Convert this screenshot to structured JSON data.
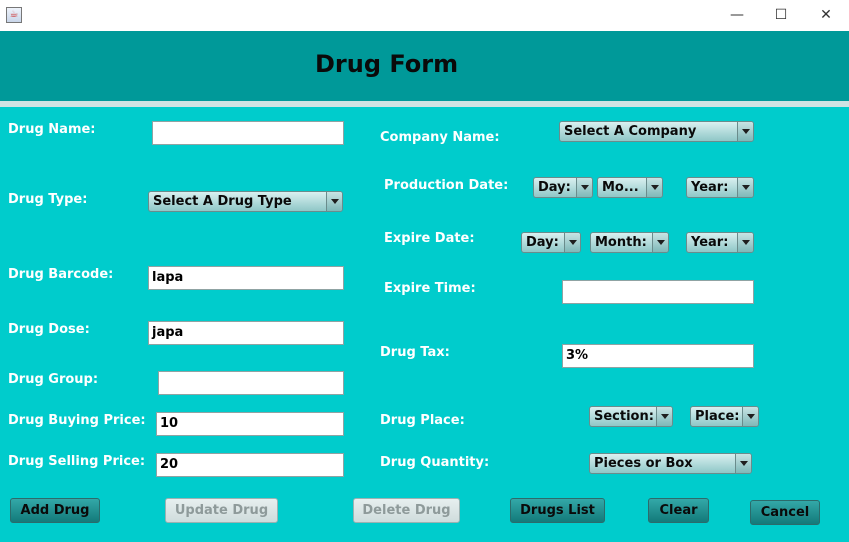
{
  "window": {
    "icon_glyph": "☕",
    "minimize": "—",
    "maximize": "☐",
    "close": "✕"
  },
  "header": {
    "title": "Drug Form"
  },
  "left": {
    "drug_name": {
      "label": "Drug Name:",
      "value": ""
    },
    "drug_type": {
      "label": "Drug Type:",
      "selected": "Select A Drug Type"
    },
    "drug_barcode": {
      "label": "Drug Barcode:",
      "value": "lapa"
    },
    "drug_dose": {
      "label": "Drug Dose:",
      "value": "japa"
    },
    "drug_group": {
      "label": "Drug Group:",
      "value": ""
    },
    "buying_price": {
      "label": "Drug Buying Price:",
      "value": "10"
    },
    "selling_price": {
      "label": "Drug Selling Price:",
      "value": "20"
    }
  },
  "right": {
    "company_name": {
      "label": "Company Name:",
      "selected": "Select A Company"
    },
    "production_date": {
      "label": "Production Date:",
      "day": "Day:",
      "month": "Mo...",
      "year": "Year:"
    },
    "expire_date": {
      "label": "Expire Date:",
      "day": "Day:",
      "month": "Month:",
      "year": "Year:"
    },
    "expire_time": {
      "label": "Expire Time:",
      "value": ""
    },
    "drug_tax": {
      "label": "Drug Tax:",
      "value": "3%"
    },
    "drug_place": {
      "label": "Drug Place:",
      "section": "Section:",
      "place": "Place:"
    },
    "drug_quantity": {
      "label": "Drug Quantity:",
      "selected": "Pieces or Box"
    }
  },
  "buttons": {
    "add": "Add Drug",
    "update": "Update Drug",
    "delete": "Delete Drug",
    "list": "Drugs List",
    "clear": "Clear",
    "cancel": "Cancel"
  },
  "colors": {
    "background": "#00cccc",
    "header": "#009999",
    "button": "#137a7a",
    "label_text": "#ffffff"
  }
}
